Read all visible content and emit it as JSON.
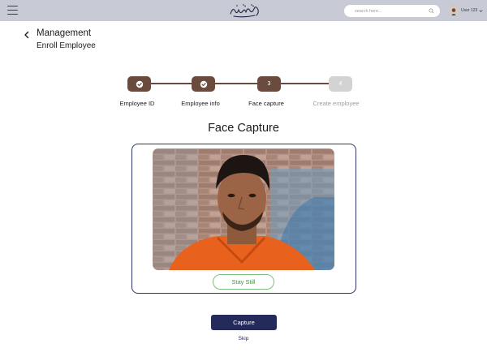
{
  "topbar": {
    "search_placeholder": "search here...",
    "user_name": "User 123"
  },
  "header": {
    "title": "Management",
    "subtitle": "Enroll Employee"
  },
  "stepper": {
    "steps": [
      {
        "label": "Employee ID",
        "state": "done",
        "marker": ""
      },
      {
        "label": "Employee info",
        "state": "done",
        "marker": ""
      },
      {
        "label": "Face capture",
        "state": "current",
        "marker": "3"
      },
      {
        "label": "Create employee",
        "state": "pending",
        "marker": "4"
      }
    ]
  },
  "main": {
    "heading": "Face Capture",
    "status": "Stay Still",
    "capture_label": "Capture",
    "skip_label": "Skip"
  },
  "colors": {
    "topbar": "#c8cad6",
    "step_active": "#6b4b3e",
    "step_pending": "#d3d3d3",
    "primary_button": "#242a5a",
    "status_green": "#3c9a3c"
  }
}
